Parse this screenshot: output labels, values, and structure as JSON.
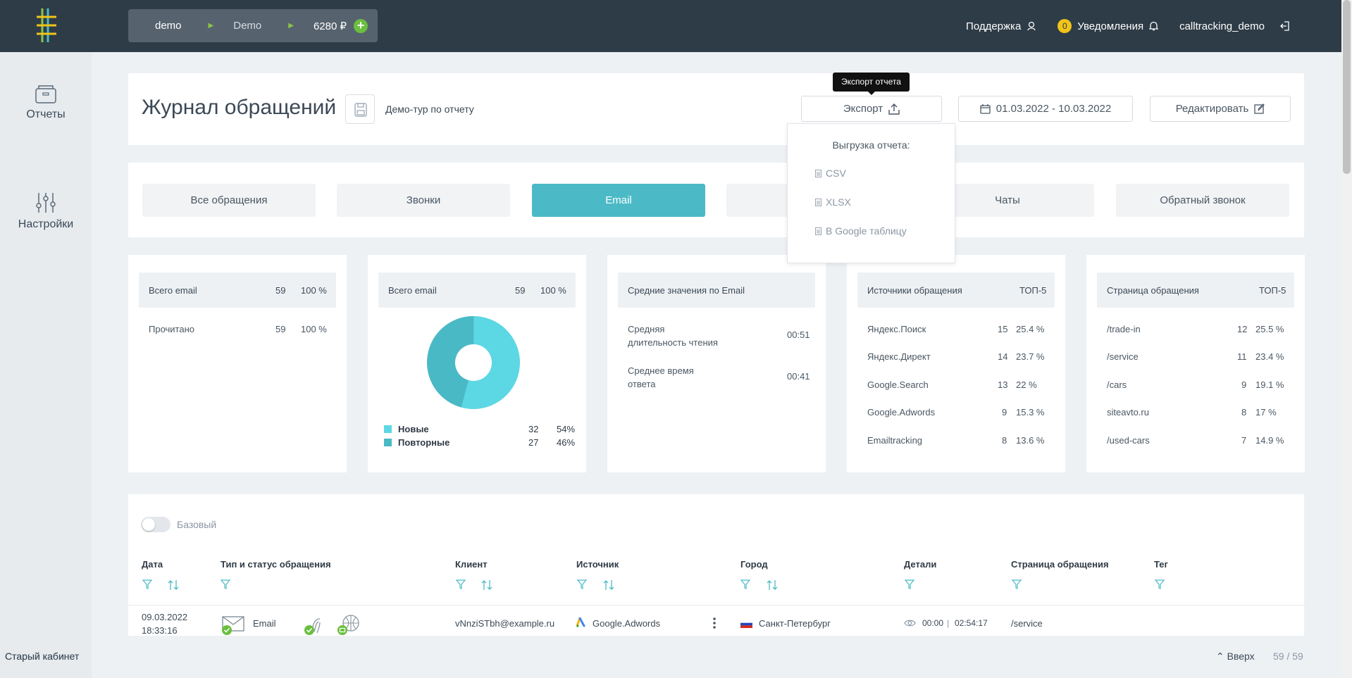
{
  "header": {
    "account": "demo",
    "project": "Demo",
    "balance": "6280 ₽",
    "support": "Поддержка",
    "notifications_count": "0",
    "notifications": "Уведомления",
    "username": "calltracking_demo"
  },
  "sidebar": {
    "reports": "Отчеты",
    "settings": "Настройки",
    "old_cabinet": "Старый кабинет"
  },
  "page": {
    "title": "Журнал обращений",
    "demo_tour": "Демо-тур по отчету",
    "export_label": "Экспорт",
    "export_tooltip": "Экспорт отчета",
    "date_range": "01.03.2022 - 10.03.2022",
    "edit_label": "Редактировать"
  },
  "export_menu": {
    "heading": "Выгрузка отчета:",
    "options": [
      "CSV",
      "XLSX",
      "В Google таблицу"
    ]
  },
  "tabs": [
    "Все обращения",
    "Звонки",
    "Email",
    "",
    "Чаты",
    "Обратный звонок"
  ],
  "active_tab": "Email",
  "cards": {
    "total": {
      "label": "Всего email",
      "count": "59",
      "pct": "100 %",
      "rows": [
        {
          "label": "Прочитано",
          "count": "59",
          "pct": "100 %"
        }
      ]
    },
    "donut": {
      "label": "Всего email",
      "count": "59",
      "pct": "100 %",
      "legend": [
        {
          "label": "Новые",
          "count": "32",
          "pct": "54%",
          "color": "#5cd7e4"
        },
        {
          "label": "Повторные",
          "count": "27",
          "pct": "46%",
          "color": "#4ab9c6"
        }
      ]
    },
    "avg": {
      "label": "Средние значения по Email",
      "rows": [
        {
          "label_1": "Средняя",
          "label_2": "длительность чтения",
          "value": "00:51"
        },
        {
          "label_1": "Среднее время",
          "label_2": "ответа",
          "value": "00:41"
        }
      ]
    },
    "sources": {
      "label": "Источники обращения",
      "top": "ТОП-5",
      "rows": [
        {
          "label": "Яндекс.Поиск",
          "count": "15",
          "pct": "25.4 %"
        },
        {
          "label": "Яндекс.Директ",
          "count": "14",
          "pct": "23.7 %"
        },
        {
          "label": "Google.Search",
          "count": "13",
          "pct": "22 %"
        },
        {
          "label": "Google.Adwords",
          "count": "9",
          "pct": "15.3 %"
        },
        {
          "label": "Emailtracking",
          "count": "8",
          "pct": "13.6 %"
        }
      ]
    },
    "pages": {
      "label": "Страница обращения",
      "top": "ТОП-5",
      "rows": [
        {
          "label": "/trade-in",
          "count": "12",
          "pct": "25.5 %"
        },
        {
          "label": "/service",
          "count": "11",
          "pct": "23.4 %"
        },
        {
          "label": "/cars",
          "count": "9",
          "pct": "19.1 %"
        },
        {
          "label": "siteavto.ru",
          "count": "8",
          "pct": "17 %"
        },
        {
          "label": "/used-cars",
          "count": "7",
          "pct": "14.9 %"
        }
      ]
    }
  },
  "table": {
    "toggle_label": "Базовый",
    "columns": [
      "Дата",
      "Тип и статус обращения",
      "Клиент",
      "Источник",
      "Город",
      "Детали",
      "Страница обращения",
      "Тег"
    ],
    "row": {
      "date": "09.03.2022",
      "time": "18:33:16",
      "type": "Email",
      "client": "vNnziSTbh@example.ru",
      "source": "Google.Adwords",
      "city": "Санкт-Петербург",
      "details_start": "00:00",
      "details_end": "02:54:17",
      "page": "/service"
    }
  },
  "footer": {
    "up": "Вверх",
    "counter": "59 / 59"
  },
  "colors": {
    "accent": "#4bbac6",
    "topbar": "#2e3c47",
    "green": "#6abf3f"
  }
}
